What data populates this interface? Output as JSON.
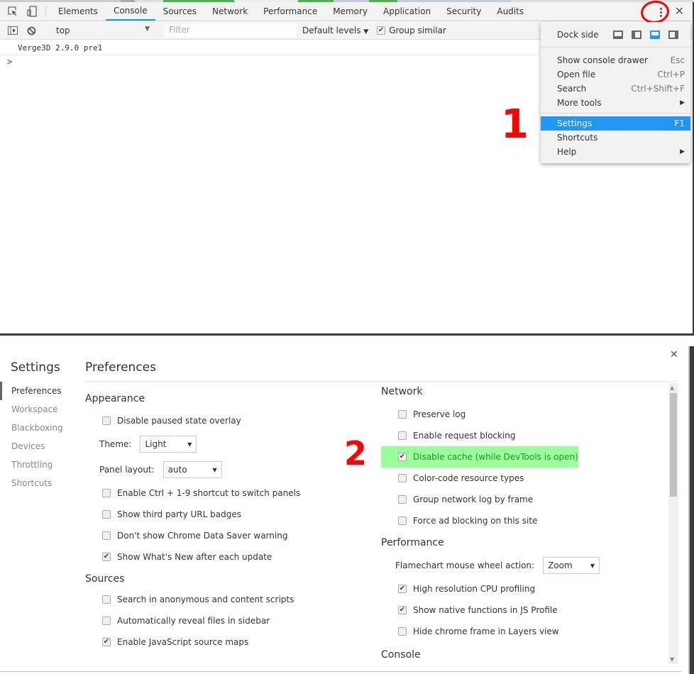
{
  "devtools": {
    "tabs": [
      "Elements",
      "Console",
      "Sources",
      "Network",
      "Performance",
      "Memory",
      "Application",
      "Security",
      "Audits"
    ],
    "active_tab": "Console",
    "context": "top",
    "filter_placeholder": "Filter",
    "levels": "Default levels",
    "group_similar": "Group similar",
    "console_lines": [
      "Verge3D 2.9.0 pre1"
    ],
    "prompt": ">"
  },
  "menu": {
    "dock_side": "Dock side",
    "items": [
      {
        "label": "Show console drawer",
        "shortcut": "Esc"
      },
      {
        "label": "Open file",
        "shortcut": "Ctrl+P"
      },
      {
        "label": "Search",
        "shortcut": "Ctrl+Shift+F"
      },
      {
        "label": "More tools",
        "shortcut": "▶"
      },
      {
        "label": "Settings",
        "shortcut": "F1"
      },
      {
        "label": "Shortcuts",
        "shortcut": ""
      },
      {
        "label": "Help",
        "shortcut": "▶"
      }
    ],
    "selected": "Settings"
  },
  "annotations": {
    "step1": "1",
    "step2": "2"
  },
  "settings": {
    "title": "Settings",
    "sidebar": [
      "Preferences",
      "Workspace",
      "Blackboxing",
      "Devices",
      "Throttling",
      "Shortcuts"
    ],
    "page_title": "Preferences",
    "appearance": {
      "heading": "Appearance",
      "disable_paused": "Disable paused state overlay",
      "theme_label": "Theme:",
      "theme_value": "Light",
      "panel_layout_label": "Panel layout:",
      "panel_layout_value": "auto",
      "ctrl_shortcut": "Enable Ctrl + 1-9 shortcut to switch panels",
      "third_party": "Show third party URL badges",
      "data_saver": "Don't show Chrome Data Saver warning",
      "whats_new": "Show What's New after each update"
    },
    "sources": {
      "heading": "Sources",
      "search_anon": "Search in anonymous and content scripts",
      "reveal_files": "Automatically reveal files in sidebar",
      "js_source_maps": "Enable JavaScript source maps"
    },
    "network": {
      "heading": "Network",
      "preserve_log": "Preserve log",
      "request_blocking": "Enable request blocking",
      "disable_cache": "Disable cache (while DevTools is open)",
      "color_code": "Color-code resource types",
      "group_frame": "Group network log by frame",
      "force_ad": "Force ad blocking on this site"
    },
    "performance": {
      "heading": "Performance",
      "flamechart_label": "Flamechart mouse wheel action:",
      "flamechart_value": "Zoom",
      "high_res": "High resolution CPU profiling",
      "native_funcs": "Show native functions in JS Profile",
      "hide_chrome": "Hide chrome frame in Layers view"
    },
    "console_heading": "Console"
  }
}
